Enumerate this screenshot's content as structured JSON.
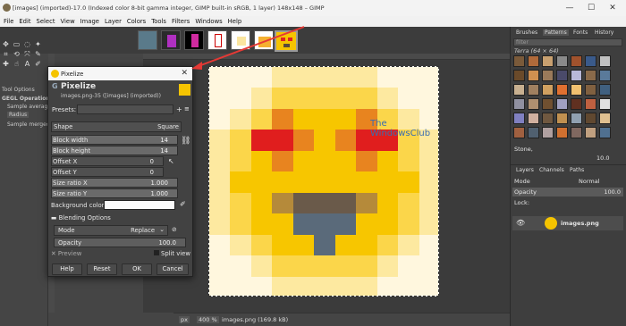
{
  "window": {
    "title": "[images] (imported)-17.0 (Indexed color 8-bit gamma integer, GIMP built-in sRGB, 1 layer) 148x148 – GIMP",
    "minimize": "—",
    "maximize": "☐",
    "close": "✕"
  },
  "menubar": [
    "File",
    "Edit",
    "Select",
    "View",
    "Image",
    "Layer",
    "Colors",
    "Tools",
    "Filters",
    "Windows",
    "Help"
  ],
  "left_dock": {
    "tool_options": "Tool Options",
    "gegl_operation": "GEGL Operation",
    "sample_average": "Sample average",
    "radius": "Radius",
    "sample_merged": "Sample merged"
  },
  "dialog": {
    "title": "Pixelize",
    "heading": "Pixelize",
    "subheading": "images.png-35 ([images] (imported))",
    "presets_label": "Presets:",
    "shape_label": "Shape",
    "shape_value": "Square",
    "block_width_label": "Block width",
    "block_width_value": "14",
    "block_height_label": "Block height",
    "block_height_value": "14",
    "offset_x_label": "Offset X",
    "offset_x_value": "0",
    "offset_y_label": "Offset Y",
    "offset_y_value": "0",
    "size_ratio_x_label": "Size ratio X",
    "size_ratio_x_value": "1.000",
    "size_ratio_y_label": "Size ratio Y",
    "size_ratio_y_value": "1.000",
    "bg_color_label": "Background color",
    "blending_options": "Blending Options",
    "mode_label": "Mode",
    "mode_value": "Replace",
    "opacity_label": "Opacity",
    "opacity_value": "100.0",
    "preview_label": "Preview",
    "split_view_label": "Split view",
    "help_btn": "Help",
    "reset_btn": "Reset",
    "ok_btn": "OK",
    "cancel_btn": "Cancel"
  },
  "canvas": {
    "watermark_line1": "The",
    "watermark_line2": "WindowsClub"
  },
  "statusbar": {
    "unit": "px",
    "zoom": "400 %",
    "info": "images.png (169.8 kB)"
  },
  "right_dock": {
    "tabs": [
      "Brushes",
      "Patterns",
      "Fonts",
      "History"
    ],
    "filter_placeholder": "filter",
    "brush_name": "Terra (64 × 64)",
    "stone_label": "Stone,",
    "spacing_value": "10.0",
    "layers_tabs": [
      "Layers",
      "Channels",
      "Paths"
    ],
    "mode_label": "Mode",
    "mode_value": "Normal",
    "opacity_label": "Opacity",
    "opacity_value": "100.0",
    "lock_label": "Lock:",
    "layer_name": "images.png"
  },
  "colors": {
    "accent_red": "#e53935",
    "emoji_yellow": "#f7c600"
  }
}
